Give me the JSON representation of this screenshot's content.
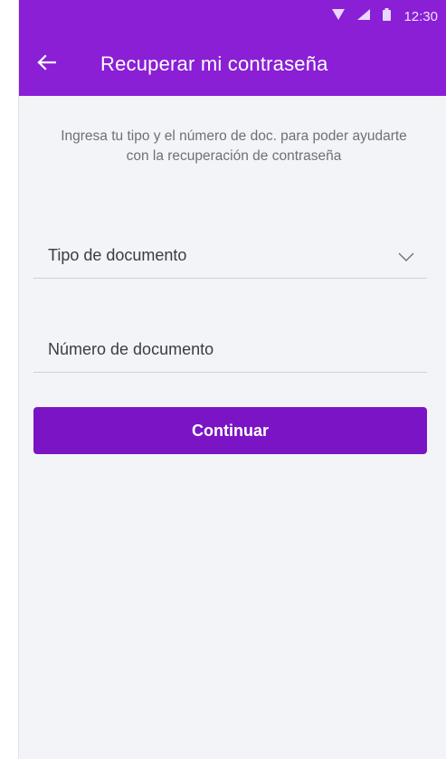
{
  "status_bar": {
    "time": "12:30",
    "icons": [
      "wifi-icon",
      "signal-icon",
      "battery-icon"
    ]
  },
  "app_bar": {
    "title": "Recuperar mi contraseña",
    "back_icon": "arrow-left-icon"
  },
  "main": {
    "subtitle": "Ingresa tu tipo y el número de doc. para poder ayudarte con la recuperación de contraseña",
    "document_type": {
      "label": "Tipo de documento",
      "icon": "chevron-down-icon"
    },
    "document_number": {
      "placeholder": "Número de documento"
    },
    "continue_label": "Continuar"
  },
  "colors": {
    "primary": "#8a1fd6",
    "button": "#7a14c4",
    "background": "#f3f4f7",
    "text_muted": "#6f7077"
  }
}
